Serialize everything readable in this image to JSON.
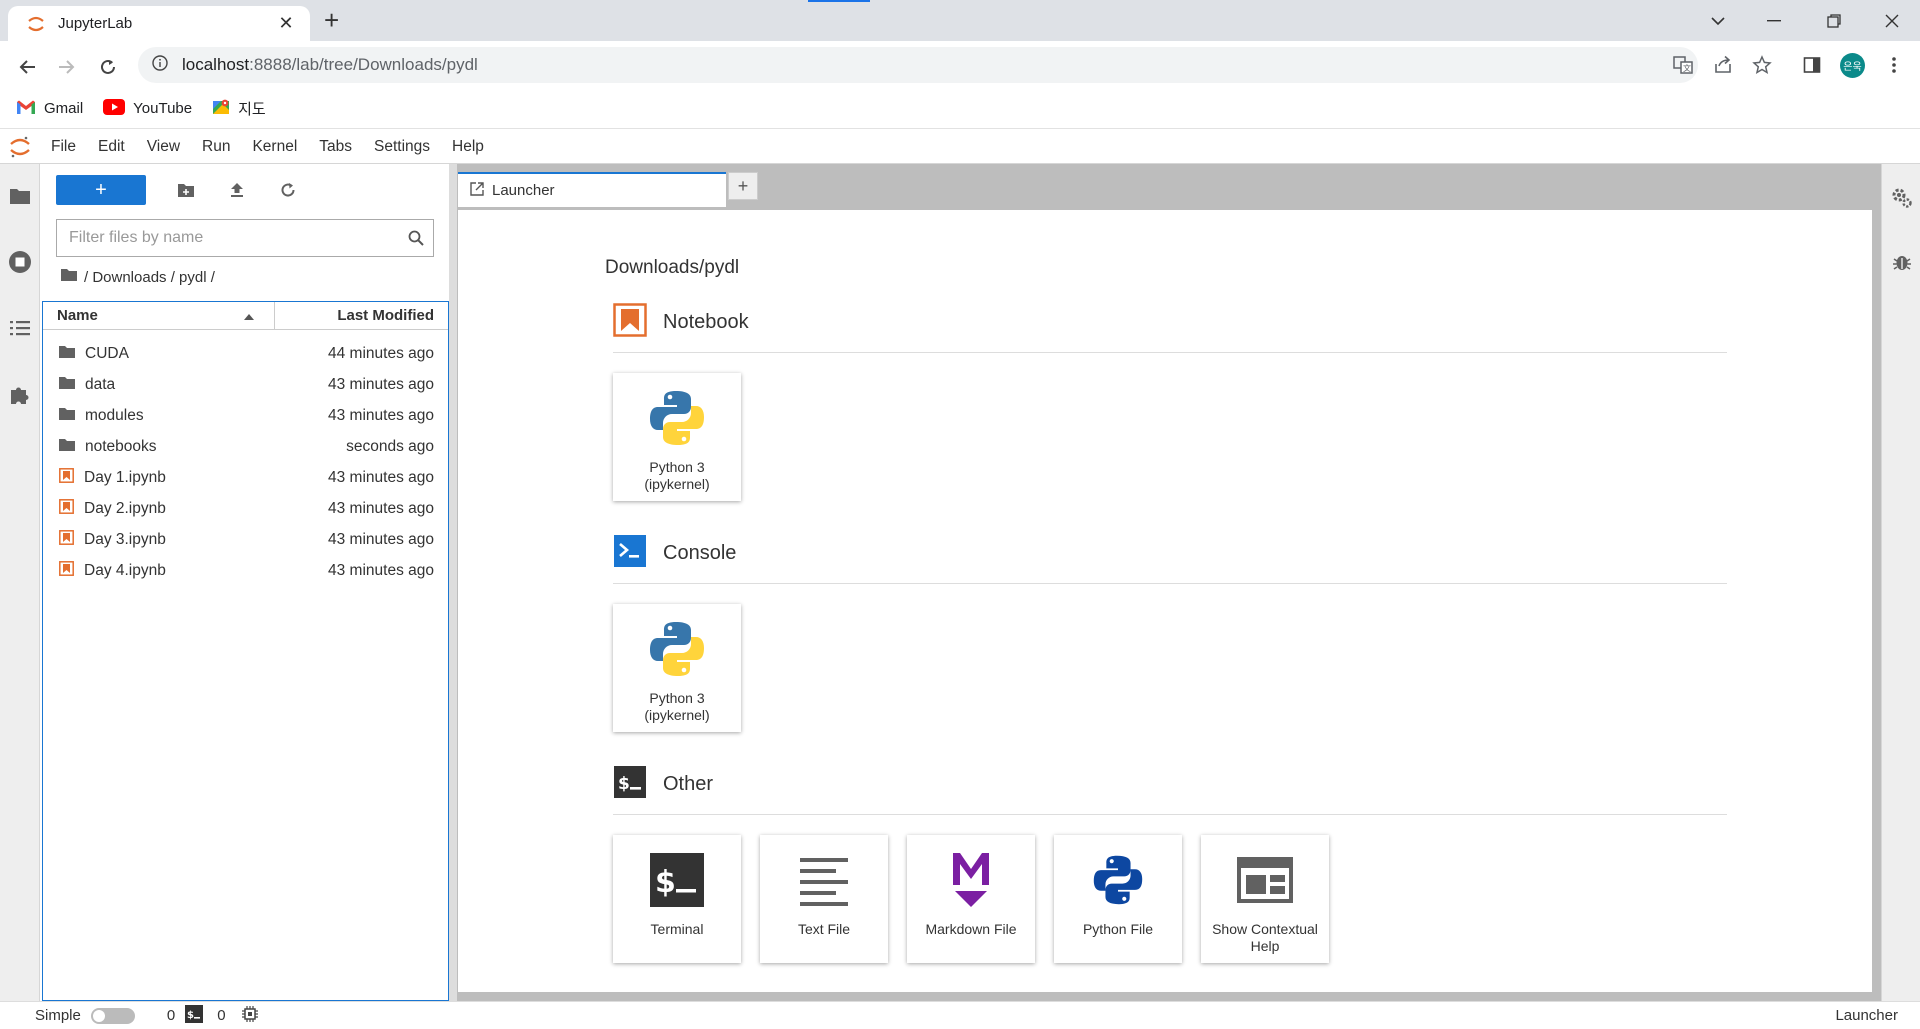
{
  "browser": {
    "tab_title": "JupyterLab",
    "url_host": "localhost",
    "url_rest": ":8888/lab/tree/Downloads/pydl",
    "profile_initials": "은욱",
    "bookmarks": [
      {
        "label": "Gmail",
        "icon": "gmail-icon"
      },
      {
        "label": "YouTube",
        "icon": "youtube-icon"
      },
      {
        "label": "지도",
        "icon": "maps-icon"
      }
    ]
  },
  "menubar": {
    "items": [
      "File",
      "Edit",
      "View",
      "Run",
      "Kernel",
      "Tabs",
      "Settings",
      "Help"
    ]
  },
  "filebrowser": {
    "new_button": "+",
    "filter_placeholder": "Filter files by name",
    "breadcrumb": "/ Downloads / pydl /",
    "header": {
      "name": "Name",
      "modified": "Last Modified"
    },
    "rows": [
      {
        "name": "CUDA",
        "modified": "44 minutes ago",
        "kind": "folder"
      },
      {
        "name": "data",
        "modified": "43 minutes ago",
        "kind": "folder"
      },
      {
        "name": "modules",
        "modified": "43 minutes ago",
        "kind": "folder"
      },
      {
        "name": "notebooks",
        "modified": "seconds ago",
        "kind": "folder"
      },
      {
        "name": "Day 1.ipynb",
        "modified": "43 minutes ago",
        "kind": "notebook"
      },
      {
        "name": "Day 2.ipynb",
        "modified": "43 minutes ago",
        "kind": "notebook"
      },
      {
        "name": "Day 3.ipynb",
        "modified": "43 minutes ago",
        "kind": "notebook"
      },
      {
        "name": "Day 4.ipynb",
        "modified": "43 minutes ago",
        "kind": "notebook"
      }
    ]
  },
  "launcher": {
    "tab_label": "Launcher",
    "cwd": "Downloads/pydl",
    "sections": {
      "notebook": {
        "title": "Notebook",
        "cards": [
          "Python 3\n(ipykernel)"
        ]
      },
      "console": {
        "title": "Console",
        "cards": [
          "Python 3\n(ipykernel)"
        ]
      },
      "other": {
        "title": "Other",
        "cards": [
          "Terminal",
          "Text File",
          "Markdown File",
          "Python File",
          "Show Contextual\nHelp"
        ]
      }
    }
  },
  "statusbar": {
    "mode_label": "Simple",
    "kernels_count": "0",
    "terminals_count": "0",
    "right_label": "Launcher"
  },
  "colors": {
    "accent": "#1976d2",
    "jupyter_orange": "#e46e2e"
  }
}
